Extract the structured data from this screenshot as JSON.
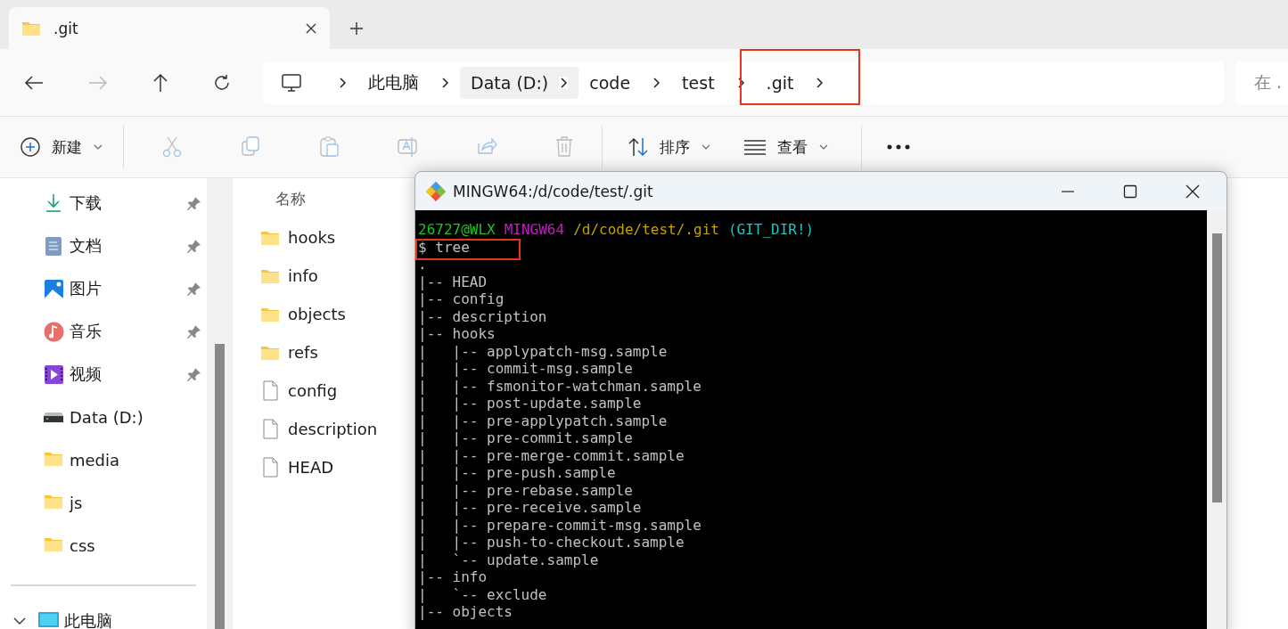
{
  "tabs": [
    {
      "title": ".git",
      "selected": true
    }
  ],
  "address": {
    "crumbs": [
      {
        "label": "此电脑",
        "highlighted": false
      },
      {
        "label": "Data (D:)",
        "highlighted": true
      },
      {
        "label": "code",
        "highlighted": false
      },
      {
        "label": "test",
        "highlighted": false
      },
      {
        "label": ".git",
        "highlighted": false
      }
    ],
    "search_placeholder": "在 ."
  },
  "toolbar": {
    "new_label": "新建",
    "sort_label": "排序",
    "view_label": "查看"
  },
  "sidebar": {
    "items": [
      {
        "label": "下载",
        "kind": "download",
        "pinned": true
      },
      {
        "label": "文档",
        "kind": "document",
        "pinned": true
      },
      {
        "label": "图片",
        "kind": "picture",
        "pinned": true
      },
      {
        "label": "音乐",
        "kind": "music",
        "pinned": true
      },
      {
        "label": "视频",
        "kind": "video",
        "pinned": true
      },
      {
        "label": "Data (D:)",
        "kind": "drive",
        "pinned": false
      },
      {
        "label": "media",
        "kind": "folder",
        "pinned": false
      },
      {
        "label": "js",
        "kind": "folder",
        "pinned": false
      },
      {
        "label": "css",
        "kind": "folder",
        "pinned": false
      }
    ],
    "this_pc": {
      "label": "此电脑",
      "expanded": true
    }
  },
  "files": {
    "column": "名称",
    "items": [
      {
        "name": "hooks",
        "kind": "folder"
      },
      {
        "name": "info",
        "kind": "folder"
      },
      {
        "name": "objects",
        "kind": "folder"
      },
      {
        "name": "refs",
        "kind": "folder"
      },
      {
        "name": "config",
        "kind": "file"
      },
      {
        "name": "description",
        "kind": "file"
      },
      {
        "name": "HEAD",
        "kind": "file"
      }
    ]
  },
  "terminal": {
    "title": "MINGW64:/d/code/test/.git",
    "prompt": [
      {
        "text": "26727@WLX",
        "color": "#1cc41c"
      },
      {
        "text": "MINGW64",
        "color": "#c41cc4"
      },
      {
        "text": "/d/code/test/.git",
        "color": "#c4a000"
      },
      {
        "text": "(GIT_DIR!)",
        "color": "#1cc4c4"
      }
    ],
    "command": "$ tree",
    "lines": [
      ".",
      "|-- HEAD",
      "|-- config",
      "|-- description",
      "|-- hooks",
      "|   |-- applypatch-msg.sample",
      "|   |-- commit-msg.sample",
      "|   |-- fsmonitor-watchman.sample",
      "|   |-- post-update.sample",
      "|   |-- pre-applypatch.sample",
      "|   |-- pre-commit.sample",
      "|   |-- pre-merge-commit.sample",
      "|   |-- pre-push.sample",
      "|   |-- pre-rebase.sample",
      "|   |-- pre-receive.sample",
      "|   |-- prepare-commit-msg.sample",
      "|   |-- push-to-checkout.sample",
      "|   `-- update.sample",
      "|-- info",
      "|   `-- exclude",
      "|-- objects"
    ]
  }
}
